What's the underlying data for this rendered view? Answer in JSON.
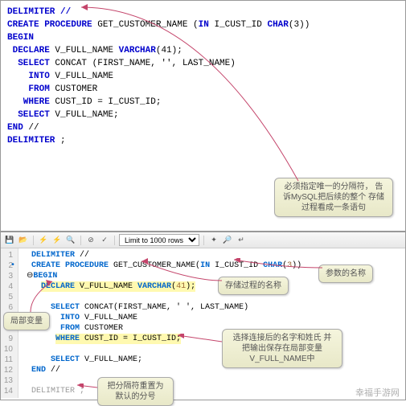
{
  "top_code": {
    "l1": "DELIMITER //",
    "l2a": "CREATE PROCEDURE",
    "l2b": " GET_CUSTOMER_NAME (",
    "l2c": "IN",
    "l2d": " I_CUST_ID ",
    "l2e": "CHAR",
    "l2f": "(3))",
    "l3": "BEGIN",
    "l4a": " DECLARE",
    "l4b": " V_FULL_NAME ",
    "l4c": "VARCHAR",
    "l4d": "(41);",
    "l5": "",
    "l6a": "  SELECT",
    "l6b": " CONCAT (FIRST_NAME, '', LAST_NAME)",
    "l7a": "    INTO",
    "l7b": " V_FULL_NAME",
    "l8a": "    FROM",
    "l8b": " CUSTOMER",
    "l9a": "   WHERE",
    "l9b": " CUST_ID = I_CUST_ID;",
    "l10": "",
    "l11a": "  SELECT",
    "l11b": " V_FULL_NAME;",
    "l12a": "END",
    "l12b": " //",
    "l13": "",
    "l14a": "DELIMITER",
    "l14b": " ;"
  },
  "callouts": {
    "c1": "必须指定唯一的分隔符，\n告诉MySQL把后续的整个\n存储过程看成一条语句",
    "c2": "存储过程的名称",
    "c3": "参数的名称",
    "c4": "局部变量",
    "c5": "选择连接后的名字和姓氏\n并把输出保存在局部变量\nV_FULL_NAME中",
    "c6": "把分隔符重置为\n默认的分号"
  },
  "toolbar": {
    "limit_label": "Limit to 1000 rows"
  },
  "editor": {
    "lines": [
      "1",
      "2",
      "3",
      "4",
      "5",
      "6",
      "7",
      "8",
      "9",
      "10",
      "11",
      "12",
      "13",
      "14"
    ],
    "l1a": "DELIMITER",
    "l1b": " //",
    "l2a": "CREATE PROCEDURE",
    "l2b": " GET_CUSTOMER_NAME(",
    "l2c": "IN",
    "l2d": " I_CUST_ID ",
    "l2e": "CHAR",
    "l2f": "(",
    "l2g": "3",
    "l2h": "))",
    "l3": "BEGIN",
    "l4a": "DECLARE",
    "l4b": " V_FULL_NAME ",
    "l4c": "VARCHAR",
    "l4d": "(",
    "l4e": "41",
    "l4f": ");",
    "l6a": "SELECT",
    "l6b": " CONCAT(FIRST_NAME, ' ', LAST_NAME)",
    "l7a": "INTO",
    "l7b": " V_FULL_NAME",
    "l8a": "FROM",
    "l8b": " CUSTOMER",
    "l9a": "WHERE",
    "l9b": " CUST_ID = I_CUST_ID;",
    "l11a": "SELECT",
    "l11b": " V_FULL_NAME;",
    "l12a": "END",
    "l12b": " //",
    "l14a": "DELIMITER ",
    "l14b": ";"
  },
  "watermark": "幸福手游网"
}
